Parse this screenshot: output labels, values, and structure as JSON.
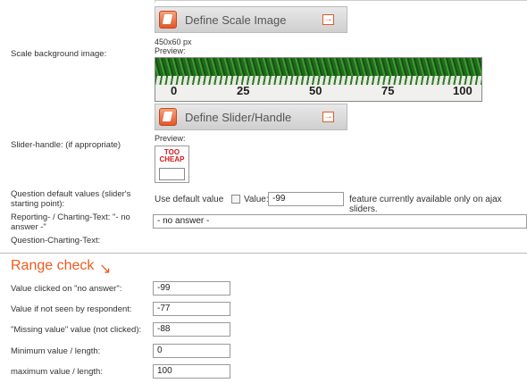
{
  "scale_section": {
    "button_label": "Define Scale Image",
    "row_label": "Scale background image:",
    "size_text": "450x60 px",
    "preview_label": "Preview:",
    "scale_numbers": [
      "0",
      "25",
      "50",
      "75",
      "100"
    ]
  },
  "slider_section": {
    "button_label": "Define Slider/Handle",
    "row_label": "Slider-handle: (if appropriate)",
    "preview_label": "Preview:",
    "handle_text": "TOO CHEAP"
  },
  "defaults": {
    "row_label": "Question default values (slider's starting point):",
    "use_default_label": "Use default value",
    "value_label": "Value:",
    "value": "-99",
    "note": "feature currently available only on ajax sliders."
  },
  "reporting": {
    "row_label": "Reporting- / Charting-Text: \"- no answer -\"",
    "value": "- no answer -"
  },
  "question_charting": {
    "row_label": "Question-Charting-Text:"
  },
  "range_check": {
    "title": "Range check",
    "arrow": "↘",
    "rows": [
      {
        "label": "Value clicked on \"no answer\":",
        "value": "-99"
      },
      {
        "label": "Value if not seen by respondent:",
        "value": "-77"
      },
      {
        "label": "\"Missing value\" value (not clicked):",
        "value": "-88"
      },
      {
        "label": "Minimum value / length:",
        "value": "0"
      },
      {
        "label": "maximum value / length:",
        "value": "100"
      }
    ]
  },
  "colors": {
    "accent": "#ee5a1e",
    "handle_text": "#d01c1c"
  }
}
